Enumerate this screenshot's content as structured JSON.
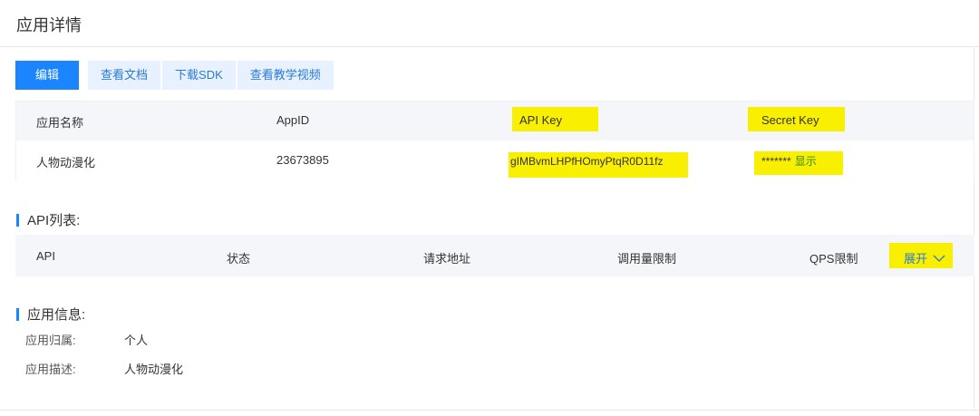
{
  "page": {
    "title": "应用详情"
  },
  "toolbar": {
    "edit_label": "编辑",
    "docs_label": "查看文档",
    "sdk_label": "下载SDK",
    "video_label": "查看教学视频"
  },
  "credentials": {
    "headers": [
      "应用名称",
      "AppID",
      "API Key",
      "Secret Key"
    ],
    "row": {
      "app_name": "人物动漫化",
      "app_id": "23673895",
      "api_key": "gIMBvmLHPfHOmyPtqR0D11fz",
      "secret_key": "*******",
      "show_label": "显示"
    }
  },
  "api_list": {
    "title": "API列表:",
    "headers": [
      "API",
      "状态",
      "请求地址",
      "调用量限制",
      "QPS限制"
    ],
    "expand_label": "展开"
  },
  "app_info": {
    "title": "应用信息:",
    "owner_label": "应用归属:",
    "owner_value": "个人",
    "desc_label": "应用描述:",
    "desc_value": "人物动漫化"
  },
  "colors": {
    "primary": "#1a85ff",
    "highlight": "#f9ef00",
    "link": "#2b7bd6",
    "show_link": "#2f8a1f"
  }
}
